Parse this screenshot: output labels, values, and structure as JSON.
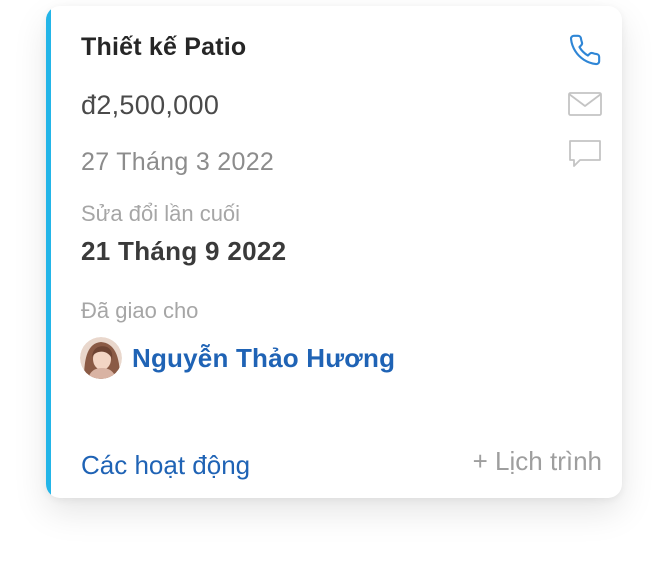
{
  "deal": {
    "title": "Thiết kế Patio",
    "amount": "đ2,500,000",
    "date": "27 Tháng 3 2022",
    "modified_label": "Sửa đổi lần cuối",
    "modified_date": "21 Tháng 9 2022",
    "assigned_label": "Đã giao cho",
    "assignee_name": "Nguyễn Thảo Hương"
  },
  "actions": {
    "icons": [
      "phone-icon",
      "mail-icon",
      "chat-icon"
    ]
  },
  "footer": {
    "activities_label": "Các hoạt động",
    "schedule_label": "+ Lịch trình"
  },
  "colors": {
    "accent": "#23b5e8",
    "link": "#1f63b5",
    "icon_blue": "#2f86d6",
    "icon_gray": "#c4c4c4"
  }
}
